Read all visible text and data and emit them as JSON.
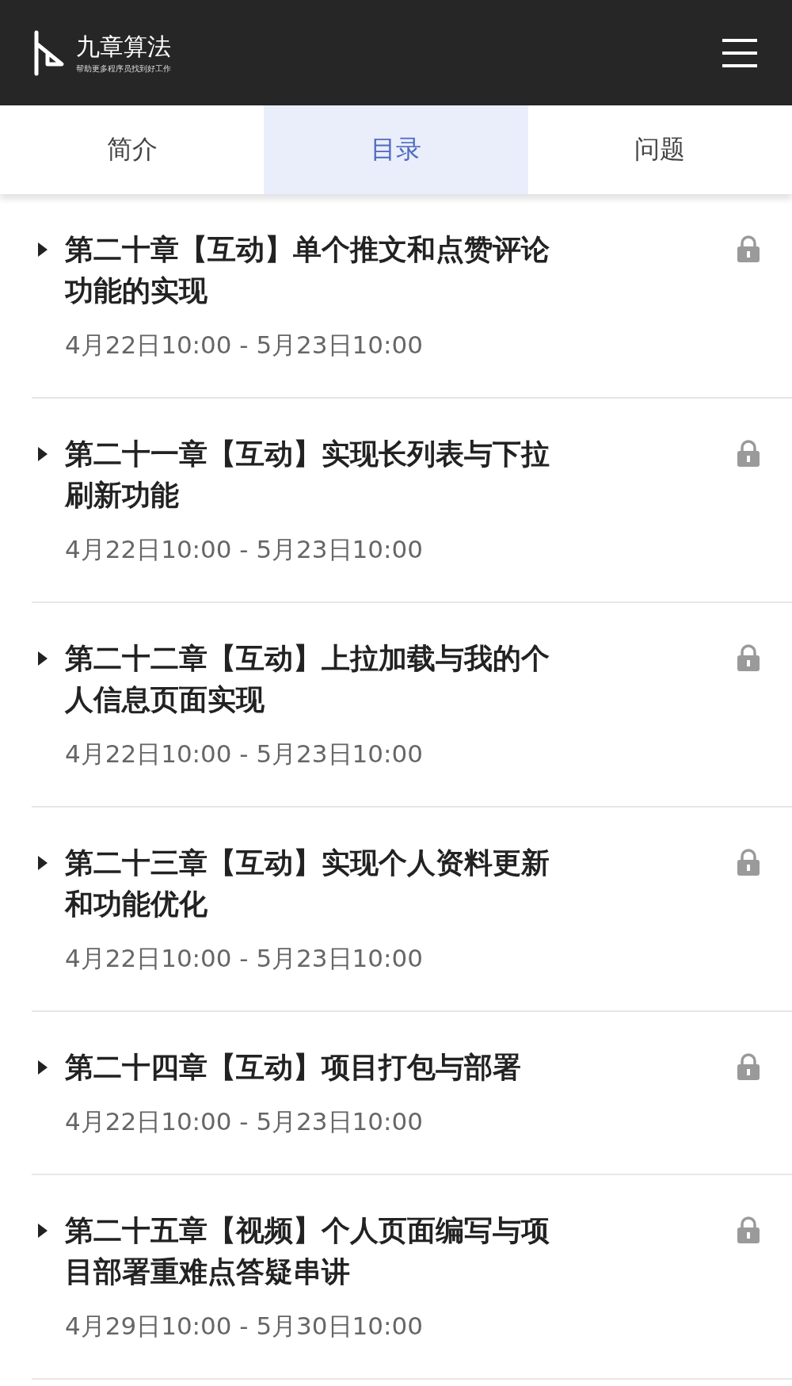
{
  "header": {
    "brand": "九章算法",
    "tagline": "帮助更多程序员找到好工作"
  },
  "tabs": [
    {
      "label": "简介",
      "selected": false
    },
    {
      "label": "目录",
      "selected": true
    },
    {
      "label": "问题",
      "selected": false
    }
  ],
  "chapters": [
    {
      "title": "第二十章【互动】单个推文和点赞评论功能的实现",
      "time": "4月22日10:00 - 5月23日10:00",
      "locked": true
    },
    {
      "title": "第二十一章【互动】实现长列表与下拉刷新功能",
      "time": "4月22日10:00 - 5月23日10:00",
      "locked": true
    },
    {
      "title": "第二十二章【互动】上拉加载与我的个人信息页面实现",
      "time": "4月22日10:00 - 5月23日10:00",
      "locked": true
    },
    {
      "title": "第二十三章【互动】实现个人资料更新和功能优化",
      "time": "4月22日10:00 - 5月23日10:00",
      "locked": true
    },
    {
      "title": "第二十四章【互动】项目打包与部署",
      "time": "4月22日10:00 - 5月23日10:00",
      "locked": true
    },
    {
      "title": "第二十五章【视频】个人页面编写与项目部署重难点答疑串讲",
      "time": "4月29日10:00 - 5月30日10:00",
      "locked": true
    }
  ]
}
